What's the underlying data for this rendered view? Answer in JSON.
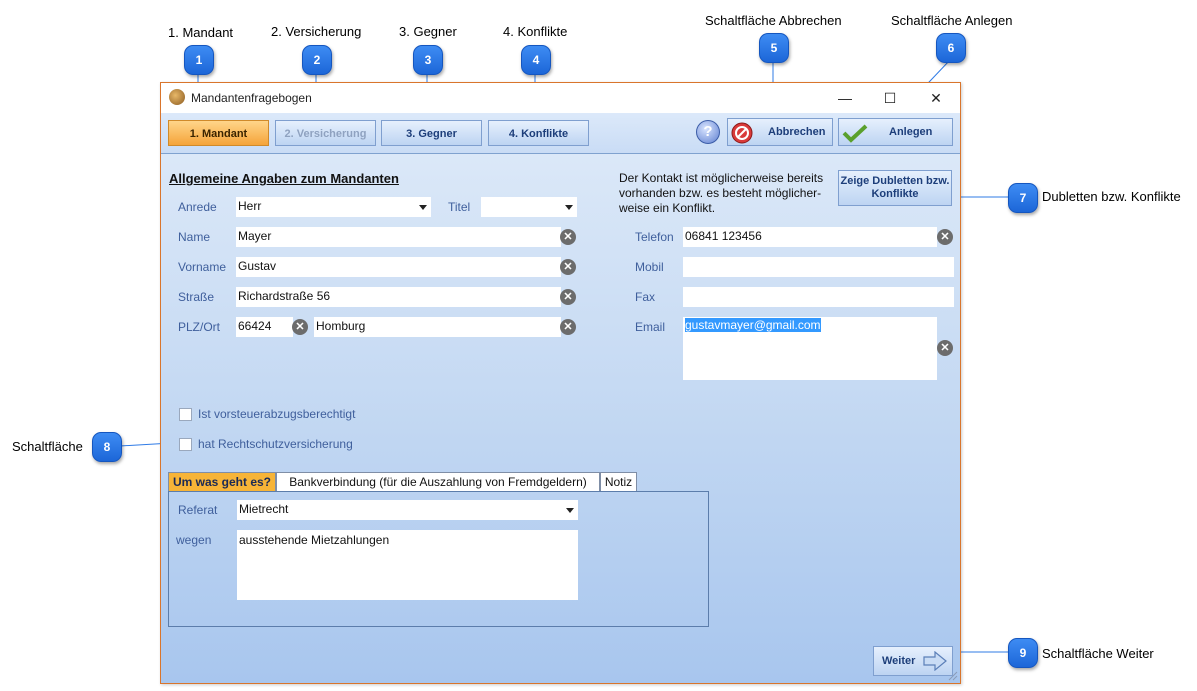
{
  "callouts": {
    "c1": {
      "num": "1",
      "label": "1. Mandant"
    },
    "c2": {
      "num": "2",
      "label": "2. Versicherung"
    },
    "c3": {
      "num": "3",
      "label": "3. Gegner"
    },
    "c4": {
      "num": "4",
      "label": "4. Konflikte"
    },
    "c5": {
      "num": "5",
      "label": "Schaltfläche Abbrechen"
    },
    "c6": {
      "num": "6",
      "label": "Schaltfläche Anlegen"
    },
    "c7": {
      "num": "7",
      "label": "Dubletten bzw. Konflikte"
    },
    "c8": {
      "num": "8",
      "label": "Schaltfläche"
    },
    "c9": {
      "num": "9",
      "label": "Schaltfläche Weiter"
    }
  },
  "window": {
    "title": "Mandantenfragebogen",
    "minimize": "—",
    "maximize": "☐",
    "close": "✕"
  },
  "toolbar": {
    "tabs": [
      "1. Mandant",
      "2. Versicherung",
      "3. Gegner",
      "4. Konflikte"
    ],
    "help": "?",
    "cancel_label": "Abbrechen",
    "create_label": "Anlegen"
  },
  "form": {
    "section_title": "Allgemeine Angaben zum Mandanten",
    "anrede_label": "Anrede",
    "anrede_value": "Herr",
    "titel_label": "Titel",
    "titel_value": "",
    "name_label": "Name",
    "name_value": "Mayer",
    "vorname_label": "Vorname",
    "vorname_value": "Gustav",
    "strasse_label": "Straße",
    "strasse_value": "Richardstraße 56",
    "plzort_label": "PLZ/Ort",
    "plz_value": "66424",
    "ort_value": "Homburg",
    "telefon_label": "Telefon",
    "telefon_value": "06841 123456",
    "mobil_label": "Mobil",
    "mobil_value": "",
    "fax_label": "Fax",
    "fax_value": "",
    "email_label": "Email",
    "email_value": "gustavmayer@gmail.com",
    "duplicate_note": "Der Kontakt ist möglicherweise bereits vorhanden bzw. es besteht möglicher-weise ein Konflikt.",
    "duplicate_button": "Zeige Dubletten bzw. Konflikte",
    "checkbox_vorsteuer": "Ist vorsteuerabzugsberechtigt",
    "checkbox_rechtsschutz": "hat Rechtschutzversicherung"
  },
  "panel": {
    "tabs": [
      "Um was geht es?",
      "Bankverbindung (für die Auszahlung von Fremdgeldern)",
      "Notiz"
    ],
    "referat_label": "Referat",
    "referat_value": "Mietrecht",
    "wegen_label": "wegen",
    "wegen_value": "ausstehende Mietzahlungen"
  },
  "footer": {
    "next_label": "Weiter"
  },
  "colors": {
    "badge": "#1c66d8",
    "active_tab": "#f5a43a",
    "window_border": "#d9752c"
  }
}
